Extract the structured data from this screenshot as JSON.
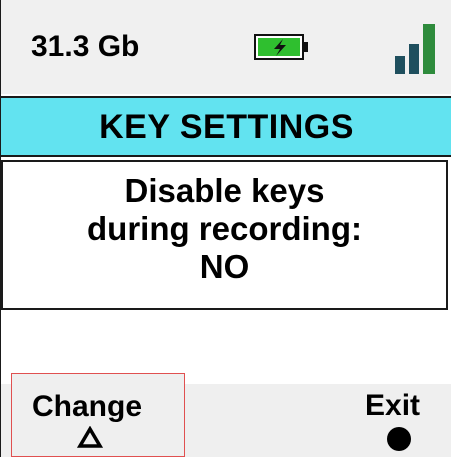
{
  "status_bar": {
    "storage": "31.3 Gb",
    "battery_icon": "battery-charging-icon",
    "signal_icon": "signal-strength-icon",
    "battery_color": "#2fbf2f"
  },
  "title": {
    "text": "KEY SETTINGS",
    "background": "#62e3f0"
  },
  "content": {
    "line1": "Disable keys",
    "line2": "during recording:",
    "value": "NO"
  },
  "softkeys": {
    "left": {
      "label": "Change",
      "icon": "triangle-up-icon"
    },
    "right": {
      "label": "Exit",
      "icon": "filled-circle-icon"
    }
  }
}
